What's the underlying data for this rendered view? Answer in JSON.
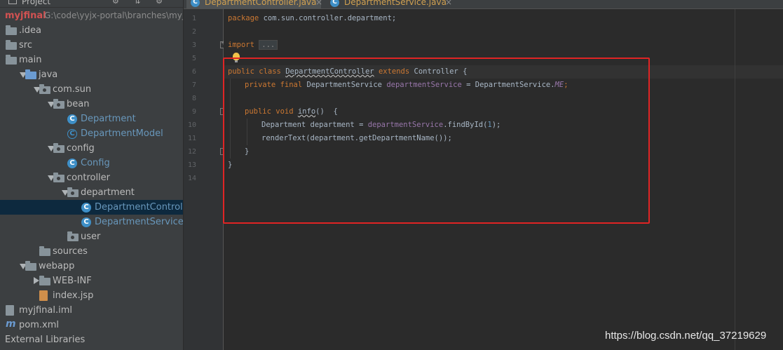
{
  "project_panel": {
    "title": "Project",
    "tools": "⚙ ⇅ ⚙ ↤"
  },
  "tree": [
    {
      "name": "root",
      "label": "myjfinal",
      "path": "G:\\code\\yyjx-portal\\branches\\myj",
      "icon": "none",
      "arrow": "none",
      "level": 0
    },
    {
      "name": "idea",
      "label": ".idea",
      "icon": "folder",
      "arrow": "none",
      "level": 0
    },
    {
      "name": "src",
      "label": "src",
      "icon": "folder",
      "arrow": "none",
      "level": 0
    },
    {
      "name": "main",
      "label": "main",
      "icon": "folder",
      "arrow": "down",
      "level": 0
    },
    {
      "name": "java",
      "label": "java",
      "icon": "folder-blue",
      "arrow": "down",
      "level": 1
    },
    {
      "name": "com-sun",
      "label": "com.sun",
      "icon": "package",
      "arrow": "down",
      "level": 2
    },
    {
      "name": "bean",
      "label": "bean",
      "icon": "package",
      "arrow": "down",
      "level": 3
    },
    {
      "name": "department-class",
      "label": "Department",
      "icon": "class",
      "arrow": "none",
      "level": 4,
      "blue": true
    },
    {
      "name": "department-model-class",
      "label": "DepartmentModel",
      "icon": "class-ring",
      "arrow": "none",
      "level": 4,
      "blue": true
    },
    {
      "name": "config",
      "label": "config",
      "icon": "package",
      "arrow": "down",
      "level": 3
    },
    {
      "name": "config-class",
      "label": "Config",
      "icon": "class",
      "arrow": "none",
      "level": 4,
      "blue": true
    },
    {
      "name": "controller",
      "label": "controller",
      "icon": "package",
      "arrow": "down",
      "level": 3
    },
    {
      "name": "department-pkg",
      "label": "department",
      "icon": "package",
      "arrow": "down",
      "level": 4
    },
    {
      "name": "department-controller-class",
      "label": "DepartmentControl",
      "icon": "class",
      "arrow": "none",
      "level": 5,
      "blue": true,
      "selected": true
    },
    {
      "name": "department-service-class",
      "label": "DepartmentService",
      "icon": "class",
      "arrow": "none",
      "level": 5,
      "blue": true
    },
    {
      "name": "user",
      "label": "user",
      "icon": "package",
      "arrow": "none",
      "level": 4
    },
    {
      "name": "sources",
      "label": "sources",
      "icon": "folder",
      "arrow": "none",
      "level": 2
    },
    {
      "name": "webapp",
      "label": "webapp",
      "icon": "folder",
      "arrow": "down",
      "level": 1
    },
    {
      "name": "web-inf",
      "label": "WEB-INF",
      "icon": "folder",
      "arrow": "right",
      "level": 2
    },
    {
      "name": "index-jsp",
      "label": "index.jsp",
      "icon": "jsp",
      "arrow": "none",
      "level": 2
    },
    {
      "name": "myjfinal-iml",
      "label": "myjfinal.iml",
      "icon": "iml",
      "arrow": "none",
      "level": 0
    },
    {
      "name": "pom-xml",
      "label": "pom.xml",
      "icon": "maven",
      "arrow": "none",
      "level": 0
    },
    {
      "name": "external-libraries",
      "label": "External Libraries",
      "icon": "none",
      "arrow": "none",
      "level": -1
    }
  ],
  "tabs": [
    {
      "label": "DepartmentController.java",
      "active": true
    },
    {
      "label": "DepartmentService.java",
      "active": false
    }
  ],
  "line_numbers": [
    "1",
    "2",
    "3",
    "5",
    "6",
    "7",
    "8",
    "9",
    "10",
    "11",
    "12",
    "13",
    "14"
  ],
  "code": {
    "l1_kw": "package",
    "l1_rest": " com.sun.controller.department;",
    "l3_kw": "import",
    "l3_dots": "...",
    "l6_kw": "public class ",
    "l6_name": "DepartmentController",
    "l6_ext": " extends ",
    "l6_rest": "Controller {",
    "l7_kw": "private final ",
    "l7_type": "DepartmentService ",
    "l7_fld": "departmentService",
    "l7_eq": " = DepartmentService.",
    "l7_me": "ME",
    "l7_end": ";",
    "l9_kw": "public void ",
    "l9_name": "info",
    "l9_rest": "()  {",
    "l10_a": "Department department = ",
    "l10_fld": "departmentService",
    "l10_b": ".findById(",
    "l10_num": "1",
    "l10_c": ");",
    "l11": "renderText(department.getDepartmentName());",
    "l12": "}",
    "l13": "}"
  },
  "watermark": "https://blog.csdn.net/qq_37219629"
}
